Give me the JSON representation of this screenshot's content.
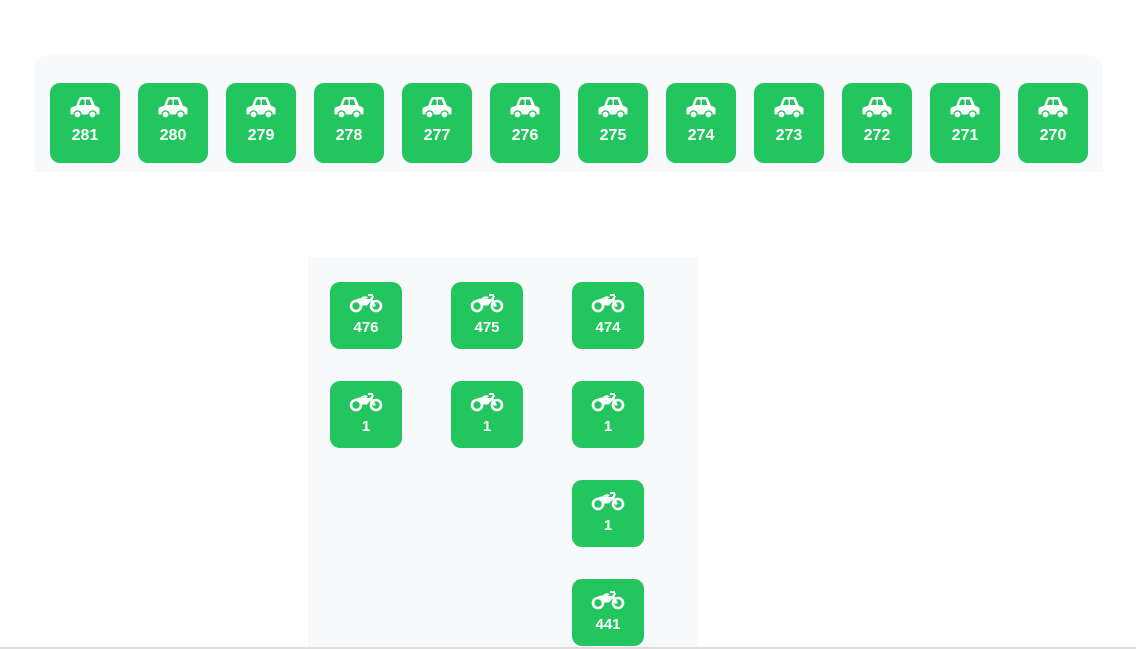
{
  "car_section": {
    "icon": "car-icon",
    "slots": [
      "281",
      "280",
      "279",
      "278",
      "277",
      "276",
      "275",
      "274",
      "273",
      "272",
      "271",
      "270"
    ]
  },
  "bike_section": {
    "icon": "motorcycle-icon",
    "slots": [
      "476",
      "475",
      "474",
      "1",
      "1",
      "1",
      "1",
      "441"
    ]
  },
  "colors": {
    "slot_green": "#22c55e",
    "panel_bg": "#f7f9fb",
    "text_white": "#ffffff"
  }
}
